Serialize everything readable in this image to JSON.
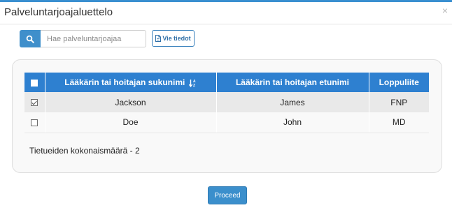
{
  "modal": {
    "title": "Palveluntarjoajaluettelo",
    "close_glyph": "×",
    "accent_color": "#3a8fd0"
  },
  "search": {
    "placeholder": "Hae palveluntarjoajaa",
    "icon": "search-icon"
  },
  "export": {
    "label": "Vie tiedot",
    "icon": "file-icon"
  },
  "table": {
    "header_color": "#2e80d0",
    "columns": [
      {
        "label": "Lääkärin tai hoitajan sukunimi",
        "sorted": true,
        "sort_icon": "sort-alpha-icon"
      },
      {
        "label": "Lääkärin tai hoitajan etunimi"
      },
      {
        "label": "Loppuliite"
      }
    ],
    "rows": [
      {
        "checked": true,
        "last_name": "Jackson",
        "first_name": "James",
        "suffix": "FNP"
      },
      {
        "checked": false,
        "last_name": "Doe",
        "first_name": "John",
        "suffix": "MD"
      }
    ]
  },
  "total_text": "Tietueiden kokonaismäärä - 2",
  "proceed": {
    "label": "Proceed",
    "color": "#3b8fcc"
  }
}
